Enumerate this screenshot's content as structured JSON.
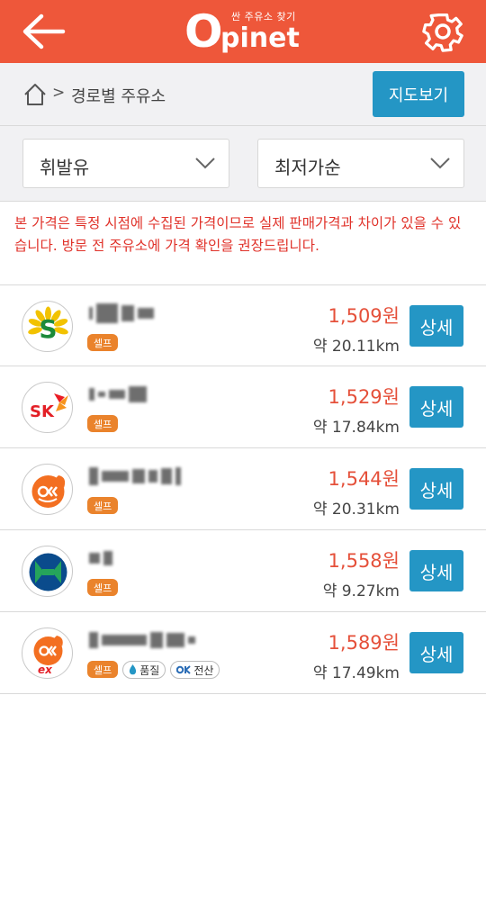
{
  "header": {
    "logo_tagline": "싼 주유소 찾기",
    "logo_o": "O",
    "logo_rest": "pinet"
  },
  "breadcrumb": {
    "separator": ">",
    "current": "경로별 주유소",
    "map_button": "지도보기"
  },
  "filters": {
    "fuel_type": "휘발유",
    "sort_order": "최저가순"
  },
  "notice": "본 가격은 특정 시점에 수집된 가격이므로 실제 판매가격과 차이가 있을 수 있습니다. 방문 전 주유소에 가격 확인을 권장드립니다.",
  "stations": [
    {
      "brand_icon": "s-oil-logo",
      "tag_self": "셀프",
      "price": "1,509원",
      "distance": "약 20.11km",
      "detail": "상세"
    },
    {
      "brand_icon": "sk-logo",
      "tag_self": "셀프",
      "price": "1,529원",
      "distance": "약 17.84km",
      "detail": "상세"
    },
    {
      "brand_icon": "gs-caltex-logo",
      "tag_self": "셀프",
      "price": "1,544원",
      "distance": "약 20.31km",
      "detail": "상세"
    },
    {
      "brand_icon": "hyundai-oilbank-logo",
      "tag_self": "셀프",
      "price": "1,558원",
      "distance": "약 9.27km",
      "detail": "상세"
    },
    {
      "brand_icon": "gs-caltex-ex-logo",
      "tag_self": "셀프",
      "tag_quality": "품질",
      "tag_ok": "전산",
      "price": "1,589원",
      "distance": "약 17.49km",
      "detail": "상세"
    }
  ],
  "colors": {
    "header": "#ee573a",
    "accent_blue": "#2496c5",
    "price_red": "#e5503a",
    "self_tag": "#ea832c",
    "notice_red": "#e0322a"
  }
}
